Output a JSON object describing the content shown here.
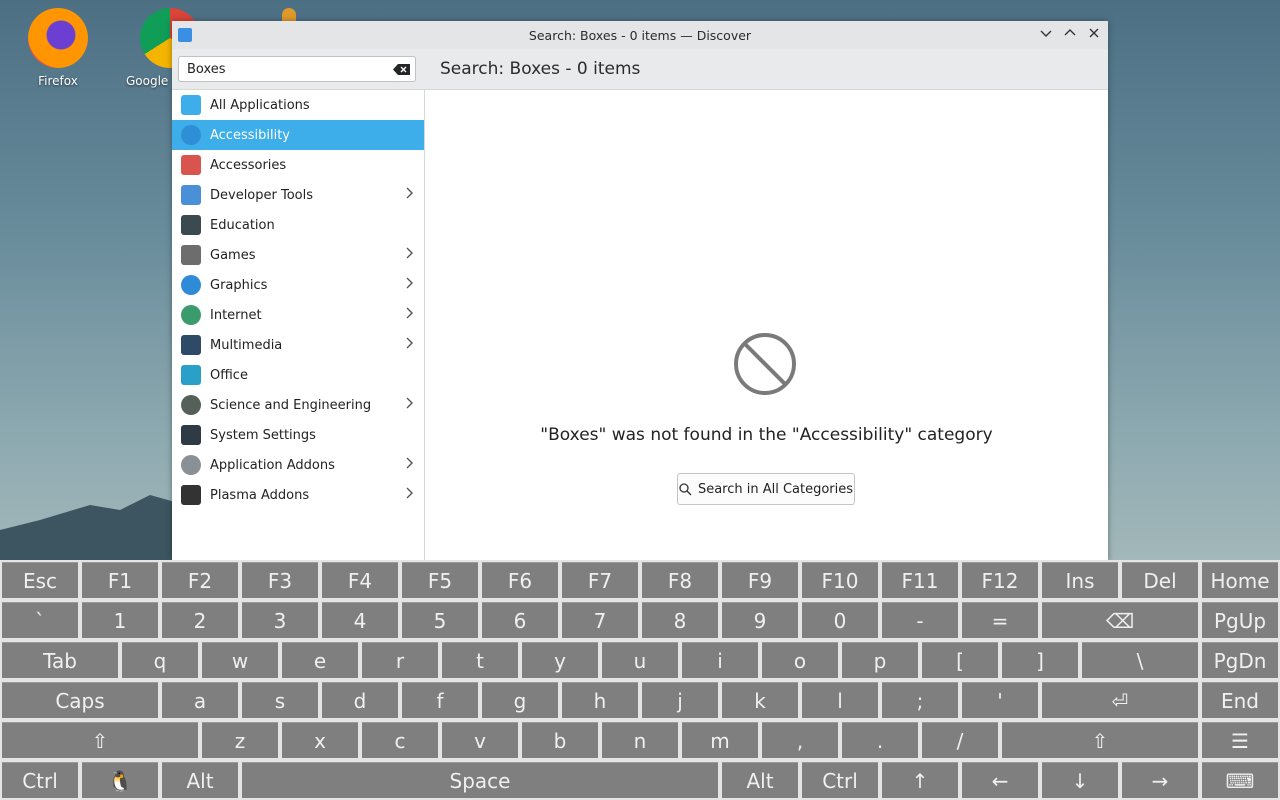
{
  "desktop": {
    "icons": [
      {
        "label": "Firefox"
      },
      {
        "label": "Google"
      }
    ]
  },
  "window": {
    "title": "Search: Boxes - 0 items — Discover",
    "search_value": "Boxes",
    "heading": "Search: Boxes - 0 items",
    "categories": [
      {
        "label": "All Applications",
        "icon": "grid-icon",
        "color": "#3daee9",
        "submenu": false
      },
      {
        "label": "Accessibility",
        "icon": "accessibility-icon",
        "color": "#2e8fd6",
        "submenu": false
      },
      {
        "label": "Accessories",
        "icon": "toolbox-icon",
        "color": "#d9534f",
        "submenu": false
      },
      {
        "label": "Developer Tools",
        "icon": "developer-icon",
        "color": "#4a90d9",
        "submenu": true
      },
      {
        "label": "Education",
        "icon": "blackboard-icon",
        "color": "#3b4a4f",
        "submenu": false
      },
      {
        "label": "Games",
        "icon": "gamepad-icon",
        "color": "#6d6d6d",
        "submenu": true
      },
      {
        "label": "Graphics",
        "icon": "graphics-icon",
        "color": "#2f8bd8",
        "submenu": true
      },
      {
        "label": "Internet",
        "icon": "globe-icon",
        "color": "#3c9b6c",
        "submenu": true
      },
      {
        "label": "Multimedia",
        "icon": "multimedia-icon",
        "color": "#2e4a66",
        "submenu": true
      },
      {
        "label": "Office",
        "icon": "office-icon",
        "color": "#2aa0c8",
        "submenu": false
      },
      {
        "label": "Science and Engineering",
        "icon": "science-icon",
        "color": "#55605a",
        "submenu": true
      },
      {
        "label": "System Settings",
        "icon": "settings-icon",
        "color": "#2f3b44",
        "submenu": false
      },
      {
        "label": "Application Addons",
        "icon": "addons-icon",
        "color": "#8a9096",
        "submenu": true
      },
      {
        "label": "Plasma Addons",
        "icon": "plasma-icon",
        "color": "#333333",
        "submenu": true
      }
    ],
    "active_category_index": 1,
    "empty_message": "\"Boxes\" was not found in the \"Accessibility\" category",
    "search_all_label": "Search in All Categories"
  },
  "keyboard": {
    "rows": [
      [
        "Esc",
        "F1",
        "F2",
        "F3",
        "F4",
        "F5",
        "F6",
        "F7",
        "F8",
        "F9",
        "F10",
        "F11",
        "F12",
        "Ins",
        "Del",
        "Home"
      ],
      [
        "`",
        "1",
        "2",
        "3",
        "4",
        "5",
        "6",
        "7",
        "8",
        "9",
        "0",
        "-",
        "=",
        "⌫",
        "PgUp"
      ],
      [
        "Tab",
        "q",
        "w",
        "e",
        "r",
        "t",
        "y",
        "u",
        "i",
        "o",
        "p",
        "[",
        "]",
        "\\",
        "PgDn"
      ],
      [
        "Caps",
        "a",
        "s",
        "d",
        "f",
        "g",
        "h",
        "j",
        "k",
        "l",
        ";",
        "'",
        "⏎",
        "End"
      ],
      [
        "⇧",
        "z",
        "x",
        "c",
        "v",
        "b",
        "n",
        "m",
        ",",
        ".",
        "/",
        "⇧",
        "☰"
      ],
      [
        "Ctrl",
        "🐧",
        "Alt",
        "Space",
        "Alt",
        "Ctrl",
        "↑",
        "←",
        "↓",
        "→",
        "⌨"
      ]
    ]
  }
}
